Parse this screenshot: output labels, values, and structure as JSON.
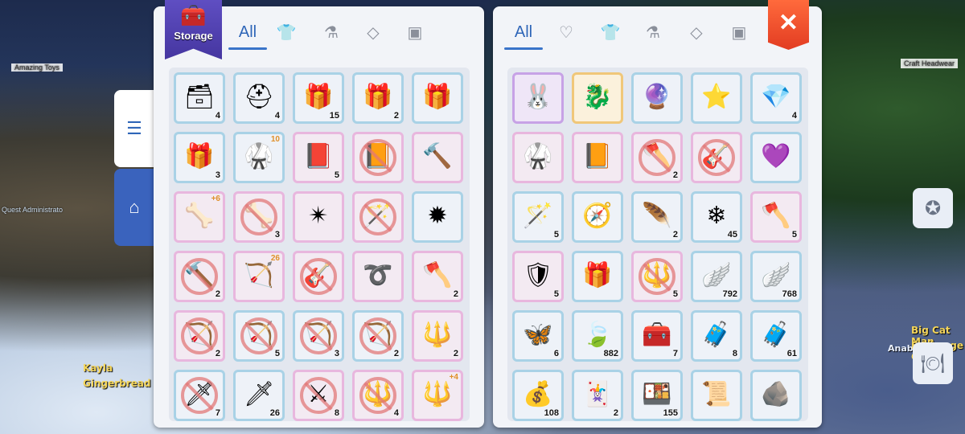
{
  "world": {
    "left_labels": [
      "Amazing Toys",
      "Quest Administrato"
    ],
    "npc_left": {
      "name": "Kayla",
      "title": "Gingerbread Ci"
    },
    "npc_right": {
      "name": "Big Cat Man",
      "title": "Exchange Ct",
      "extra": "Anabel"
    },
    "right_label": "Craft Headwear"
  },
  "storage": {
    "badge_label": "Storage",
    "tabs": [
      {
        "label": "All",
        "active": true
      },
      {
        "icon": "armor-icon"
      },
      {
        "icon": "potion-icon"
      },
      {
        "icon": "gem-icon"
      },
      {
        "icon": "card-icon"
      }
    ],
    "items": [
      {
        "icon": "blue-box-icon",
        "count": "4",
        "frame": "blue"
      },
      {
        "icon": "first-aid-box-icon",
        "count": "4",
        "frame": "blue"
      },
      {
        "icon": "gold-chest-icon",
        "count": "15",
        "frame": "blue"
      },
      {
        "icon": "gold-chest-icon",
        "count": "2",
        "frame": "blue"
      },
      {
        "icon": "gold-chest-icon",
        "count": "",
        "frame": "blue"
      },
      {
        "icon": "gold-chest-icon",
        "count": "3",
        "frame": "blue"
      },
      {
        "icon": "costume-icon",
        "count": "",
        "frame": "blue",
        "badge": "10"
      },
      {
        "icon": "spellbook-icon",
        "count": "5",
        "frame": "pink"
      },
      {
        "icon": "book-icon",
        "count": "",
        "frame": "pink",
        "banned": true
      },
      {
        "icon": "mace-icon",
        "count": "",
        "frame": "pink"
      },
      {
        "icon": "claw-icon",
        "count": "",
        "frame": "pink",
        "badge": "+6"
      },
      {
        "icon": "claw-icon",
        "count": "3",
        "frame": "pink",
        "banned": true
      },
      {
        "icon": "shuriken-icon",
        "count": "",
        "frame": "pink"
      },
      {
        "icon": "staff-icon",
        "count": "",
        "frame": "pink",
        "banned": true
      },
      {
        "icon": "spiked-weapon-icon",
        "count": "",
        "frame": "blue"
      },
      {
        "icon": "mace-icon",
        "count": "2",
        "frame": "pink",
        "banned": true
      },
      {
        "icon": "bow-icon",
        "count": "",
        "frame": "pink",
        "badge": "26"
      },
      {
        "icon": "guitar-icon",
        "count": "",
        "frame": "pink",
        "banned": true
      },
      {
        "icon": "whip-icon",
        "count": "",
        "frame": "pink"
      },
      {
        "icon": "axe-icon",
        "count": "2",
        "frame": "pink"
      },
      {
        "icon": "bow-icon",
        "count": "2",
        "frame": "pink",
        "banned": true
      },
      {
        "icon": "bow-icon",
        "count": "5",
        "frame": "blue",
        "banned": true
      },
      {
        "icon": "bow-icon",
        "count": "3",
        "frame": "blue",
        "banned": true
      },
      {
        "icon": "bow-icon",
        "count": "2",
        "frame": "blue",
        "banned": true
      },
      {
        "icon": "spear-icon",
        "count": "2",
        "frame": "pink"
      },
      {
        "icon": "dagger-icon",
        "count": "7",
        "frame": "blue",
        "banned": true
      },
      {
        "icon": "dagger-icon",
        "count": "26",
        "frame": "blue"
      },
      {
        "icon": "sword-icon",
        "count": "8",
        "frame": "pink",
        "banned": true
      },
      {
        "icon": "spear-icon",
        "count": "4",
        "frame": "pink",
        "banned": true
      },
      {
        "icon": "spear-icon",
        "count": "",
        "frame": "pink",
        "badge": "+4"
      }
    ]
  },
  "bag": {
    "tabs": [
      {
        "label": "All",
        "active": true
      },
      {
        "icon": "heart-icon"
      },
      {
        "icon": "armor-icon"
      },
      {
        "icon": "potion-icon"
      },
      {
        "icon": "gem-icon"
      },
      {
        "icon": "card-icon"
      }
    ],
    "items": [
      {
        "icon": "character-card-icon",
        "count": "",
        "frame": "purple"
      },
      {
        "icon": "dragon-card-icon",
        "count": "",
        "frame": "gold"
      },
      {
        "icon": "dark-orb-icon",
        "count": "",
        "frame": "blue"
      },
      {
        "icon": "star-badge-icon",
        "count": "",
        "frame": "blue"
      },
      {
        "icon": "blue-crystal-icon",
        "count": "4",
        "frame": "blue"
      },
      {
        "icon": "costume-icon",
        "count": "",
        "frame": "pink"
      },
      {
        "icon": "book-icon",
        "count": "",
        "frame": "pink"
      },
      {
        "icon": "axe-icon",
        "count": "2",
        "frame": "pink",
        "banned": true
      },
      {
        "icon": "guitar-icon",
        "count": "",
        "frame": "pink",
        "banned": true
      },
      {
        "icon": "heart-icon",
        "count": "",
        "frame": "blue"
      },
      {
        "icon": "staff-icon",
        "count": "5",
        "frame": "blue"
      },
      {
        "icon": "compass-icon",
        "count": "",
        "frame": "blue"
      },
      {
        "icon": "feather-icon",
        "count": "2",
        "frame": "blue"
      },
      {
        "icon": "ice-crystal-icon",
        "count": "45",
        "frame": "blue"
      },
      {
        "icon": "axe-icon",
        "count": "5",
        "frame": "pink"
      },
      {
        "icon": "armor-icon",
        "count": "5",
        "frame": "pink"
      },
      {
        "icon": "gold-chest-icon",
        "count": "",
        "frame": "blue"
      },
      {
        "icon": "spear-icon",
        "count": "5",
        "frame": "pink",
        "banned": true
      },
      {
        "icon": "wing-icon",
        "count": "792",
        "frame": "blue"
      },
      {
        "icon": "wing-icon",
        "count": "768",
        "frame": "blue"
      },
      {
        "icon": "butterfly-icon",
        "count": "6",
        "frame": "blue"
      },
      {
        "icon": "leaf-icon",
        "count": "882",
        "frame": "blue"
      },
      {
        "icon": "silver-chest-icon",
        "count": "7",
        "frame": "blue"
      },
      {
        "icon": "bronze-chest-icon",
        "count": "8",
        "frame": "blue"
      },
      {
        "icon": "bronze-chest-icon",
        "count": "61",
        "frame": "blue"
      },
      {
        "icon": "coin-bag-icon",
        "count": "108",
        "frame": "blue"
      },
      {
        "icon": "card-icon",
        "count": "2",
        "frame": "blue"
      },
      {
        "icon": "food-box-icon",
        "count": "155",
        "frame": "blue"
      },
      {
        "icon": "scroll-icon",
        "count": "",
        "frame": "blue"
      },
      {
        "icon": "ore-icon",
        "count": "",
        "frame": "blue"
      }
    ]
  },
  "colors": {
    "accent": "#3a74c9",
    "close": "#e8442a",
    "badge": "#4a3bb0"
  }
}
